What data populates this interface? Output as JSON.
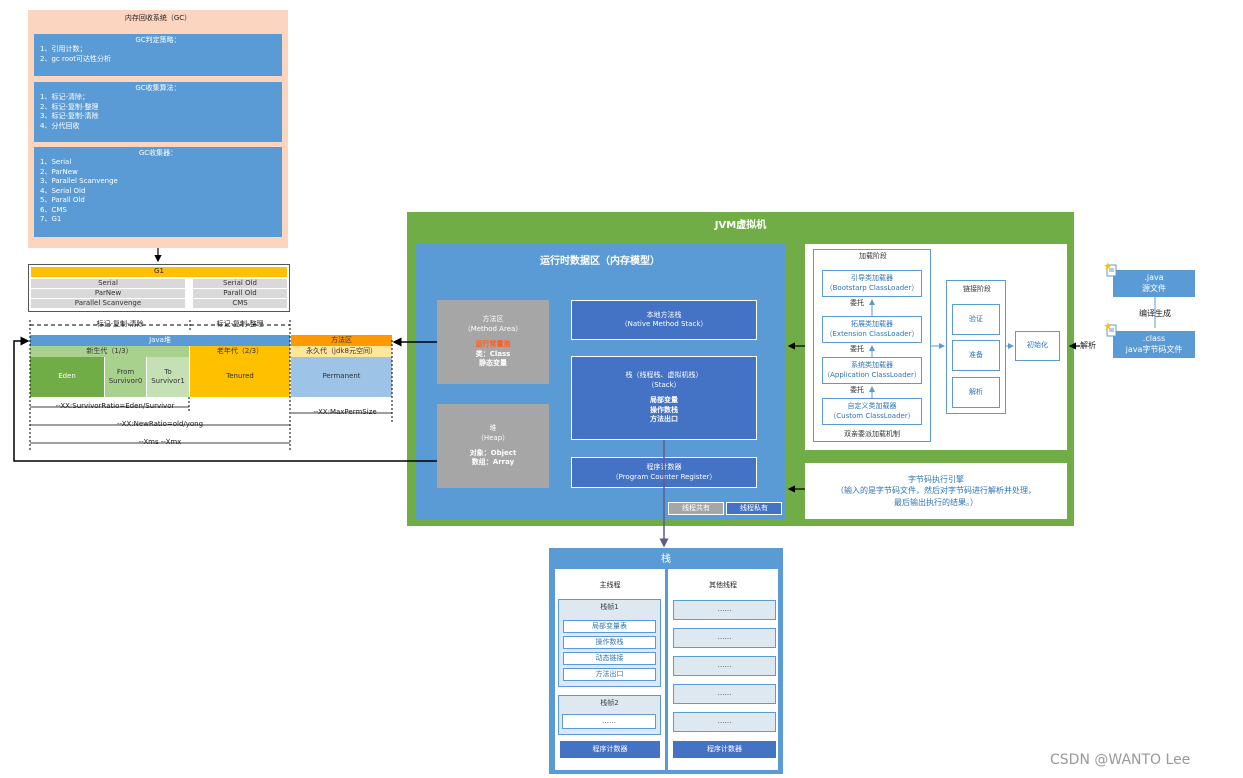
{
  "gc": {
    "title": "内存回收系统（GC）",
    "strategy": {
      "title": "GC判定策略：",
      "lines": [
        "1、引用计数；",
        "2、gc root可达性分析"
      ]
    },
    "algorithm": {
      "title": "GC收集算法：",
      "lines": [
        "1、标记-清除；",
        "2、标记-复制-整理",
        "3、标记-复制-清除",
        "4、分代回收"
      ]
    },
    "collectors": {
      "title": "GC收集器：",
      "lines": [
        "1、Serial",
        "2、ParNew",
        "3、Parallel Scanvenge",
        "4、Serial Old",
        "5、Parall Old",
        "6、CMS",
        "7、G1"
      ]
    }
  },
  "collector_table": {
    "g1": "G1",
    "young": [
      "Serial",
      "ParNew",
      "Parallel Scanvenge"
    ],
    "old": [
      "Serial Old",
      "Parall Old",
      "CMS"
    ]
  },
  "heap_layout": {
    "young_algo": "标记-复制-清除",
    "old_algo": "标记-复制-整理",
    "java_heap": "Java堆",
    "method_area": "方法区",
    "young_gen": "新生代（1/3）",
    "old_gen": "老年代（2/3）",
    "perm_gen": "永久代（jdk8元空间）",
    "eden": "Eden",
    "from": "From Survivor0",
    "to": "To Survivor1",
    "tenured": "Tenured",
    "permanent": "Permanent",
    "ratio1": "--XX:SurvivorRatio=Eden/Survivor",
    "ratio2": "--XX:MaxPermSize",
    "ratio3": "--XX:NewRatio=old/yong",
    "ratio4": "--Xms   --Xmx"
  },
  "jvm": {
    "title": "JVM虚拟机",
    "runtime": {
      "title": "运行时数据区（内存模型）",
      "method_area": {
        "title": "方法区",
        "sub": "（Method Area）",
        "red": "运行常量池",
        "items": [
          "类：Class",
          "静态变量"
        ]
      },
      "heap": {
        "title": "堆",
        "sub": "（Heap）",
        "items": [
          "对象：Object",
          "数组：Array"
        ]
      },
      "native_stack": {
        "title": "本地方法栈",
        "sub": "（Native Method Stack）"
      },
      "stack": {
        "title": "栈（线程栈、虚拟机栈）",
        "sub": "（Stack）",
        "items": [
          "局部变量",
          "操作数栈",
          "方法出口"
        ]
      },
      "pc": {
        "title": "程序计数器",
        "sub": "（Program Counter Register）"
      },
      "legend_shared": "线程共有",
      "legend_private": "线程私有"
    },
    "loader": {
      "load_phase": "加载阶段",
      "bootstrap": {
        "name": "引导类加载器",
        "sub": "（Bootstarp ClassLoader）"
      },
      "extension": {
        "name": "拓展类加载器",
        "sub": "（Extension ClassLoader）"
      },
      "application": {
        "name": "系统类加载器",
        "sub": "（Application ClassLoader）"
      },
      "custom": {
        "name": "自定义类加载器",
        "sub": "（Custom ClassLoader）"
      },
      "delegate": "委托",
      "parent_model": "双亲委派加载机制",
      "link_phase": "链接阶段",
      "verify": "验证",
      "prepare": "准备",
      "resolve": "解析",
      "init": "初始化"
    },
    "engine": {
      "title": "字节码执行引擎",
      "desc1": "（输入的是字节码文件，然后对字节码进行解析并处理，",
      "desc2": "最后输出执行的结果。）"
    }
  },
  "files": {
    "java_ext": ".java",
    "java_name": "源文件",
    "compile": "编译生成",
    "class_ext": ".class",
    "class_name": "java字节码文件",
    "parse": "解析"
  },
  "stack_detail": {
    "title": "栈",
    "main_thread": "主线程",
    "other_threads": "其他线程",
    "frame1": "栈帧1",
    "frame1_items": [
      "局部变量表",
      "操作数栈",
      "动态链接",
      "方法出口"
    ],
    "frame2": "栈帧2",
    "ellipsis": "……",
    "pc": "程序计数器"
  },
  "watermark": "CSDN @WANTO Lee",
  "colors": {
    "green": "#70ad47",
    "blue": "#5b9bd5",
    "dark_blue": "#4472c4",
    "peach": "#fbd5c0",
    "gold": "#ffc000",
    "orange": "#ff9900"
  }
}
